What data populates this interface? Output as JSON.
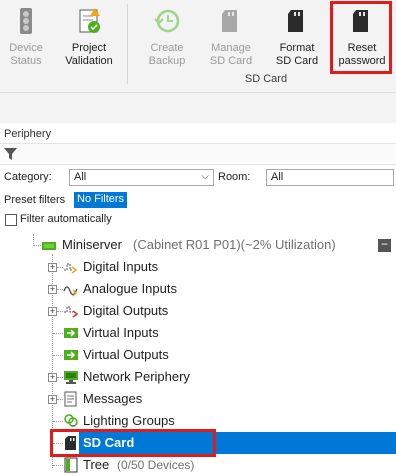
{
  "ribbon": {
    "buttons": [
      {
        "label": "Device\nStatus",
        "icon": "traffic-light-icon",
        "enabled": false
      },
      {
        "label": "Project\nValidation",
        "icon": "validation-icon",
        "enabled": true
      },
      {
        "label": "Create\nBackup",
        "icon": "backup-clock-icon",
        "enabled": false
      },
      {
        "label": "Manage\nSD Card",
        "icon": "sd-card-icon",
        "enabled": false
      },
      {
        "label": "Format\nSD Card",
        "icon": "sd-card-icon",
        "enabled": true
      },
      {
        "label": "Reset\npassword",
        "icon": "sd-card-icon",
        "enabled": true
      }
    ],
    "group_label": "SD Card"
  },
  "periphery": {
    "title": "Periphery",
    "category_label": "Category:",
    "category_value": "All",
    "room_label": "Room:",
    "room_value": "All",
    "preset_label": "Preset filters",
    "preset_value": "No Filters",
    "filter_auto_label": "Filter automatically"
  },
  "tree": {
    "root": {
      "name": "Miniserver",
      "detail": "(Cabinet R01 P01)(~2% Utilization)"
    },
    "items": [
      {
        "label": "Digital Inputs",
        "icon": "digital-inputs-icon",
        "expandable": true
      },
      {
        "label": "Analogue Inputs",
        "icon": "analogue-inputs-icon",
        "expandable": true
      },
      {
        "label": "Digital Outputs",
        "icon": "digital-outputs-icon",
        "expandable": true
      },
      {
        "label": "Virtual Inputs",
        "icon": "virtual-inputs-icon",
        "expandable": false
      },
      {
        "label": "Virtual Outputs",
        "icon": "virtual-outputs-icon",
        "expandable": false
      },
      {
        "label": "Network Periphery",
        "icon": "network-icon",
        "expandable": true
      },
      {
        "label": "Messages",
        "icon": "messages-icon",
        "expandable": true
      },
      {
        "label": "Lighting Groups",
        "icon": "lighting-groups-icon",
        "expandable": false
      },
      {
        "label": "SD Card",
        "icon": "sd-card-icon",
        "expandable": false,
        "selected": true
      },
      {
        "label": "Tree",
        "detail": "(0/50 Devices)",
        "icon": "tree-icon",
        "expandable": false
      }
    ]
  },
  "colors": {
    "selection": "#0078d7",
    "highlight": "#e01c1c",
    "accent_green": "#4caf1e"
  }
}
